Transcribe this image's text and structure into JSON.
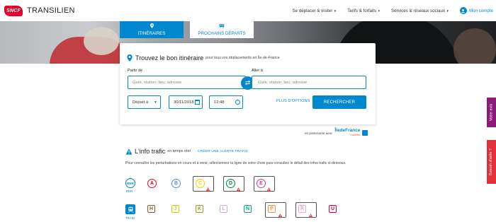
{
  "header": {
    "logo_text": "SNCF",
    "brand": "TRANSILIEN",
    "nav": [
      {
        "label": "Se déplacer & visiter"
      },
      {
        "label": "Tarifs & forfaits"
      },
      {
        "label": "Services & réseaux sociaux"
      }
    ],
    "account_label": "Mon compte"
  },
  "tabs": [
    {
      "label": "ITINÉRAIRES",
      "icon": "pin-icon",
      "active": true
    },
    {
      "label": "PROCHAINS DÉPARTS",
      "icon": "train-icon",
      "active": false
    }
  ],
  "search": {
    "title": "Trouvez le bon itinéraire",
    "subtitle": "pour tous vos déplacements en Île-de-France",
    "from_label": "Partir de",
    "from_placeholder": "Gare, station, lieu, adresse",
    "to_label": "Aller à",
    "to_placeholder": "Gare, station, lieu, adresse",
    "mode_value": "Départ à",
    "date_value": "30/11/2018",
    "time_value": "12:48",
    "more_options": "PLUS D'OPTIONS",
    "submit": "RECHERCHER"
  },
  "partner": {
    "text": "en partenariat avec",
    "name": "ÎledeFrance",
    "subname": "mobilités"
  },
  "trafic": {
    "title": "L'info trafic",
    "subtitle": "en temps réel",
    "alert_link": "CRÉER UNE ALERTE TRAFIC",
    "description": "Pour connaître les perturbations en cours et à venir, sélectionnez la ligne de votre choix puis consultez le détail des infos trafic ci-dessous.",
    "rer_mode": {
      "badge": "RER",
      "label": "RER"
    },
    "train_mode": {
      "label": "TRAIN"
    },
    "rer_lines": [
      {
        "letter": "A",
        "color": "#e3051b",
        "disturbed": false
      },
      {
        "letter": "B",
        "color": "#5291ce",
        "disturbed": false
      },
      {
        "letter": "C",
        "color": "#ffcd00",
        "disturbed": true
      },
      {
        "letter": "D",
        "color": "#00814f",
        "disturbed": true
      },
      {
        "letter": "E",
        "color": "#c04191",
        "disturbed": true
      }
    ],
    "train_lines": [
      {
        "letter": "H",
        "color": "#8d5e2a",
        "disturbed": false
      },
      {
        "letter": "J",
        "color": "#cdcd00",
        "disturbed": false
      },
      {
        "letter": "K",
        "color": "#9f9825",
        "disturbed": false
      },
      {
        "letter": "L",
        "color": "#ceadd2",
        "disturbed": false
      },
      {
        "letter": "N",
        "color": "#00a092",
        "disturbed": false
      },
      {
        "letter": "P",
        "color": "#f28e42",
        "disturbed": true
      },
      {
        "letter": "R",
        "color": "#f4a6b9",
        "disturbed": true
      },
      {
        "letter": "U",
        "color": "#b90845",
        "disturbed": false
      }
    ]
  },
  "side_tabs": {
    "feedback": "Votre avis",
    "help": "Besoin d'aide ?"
  },
  "colors": {
    "accent": "#0088ce",
    "warning": "#e2303a"
  }
}
